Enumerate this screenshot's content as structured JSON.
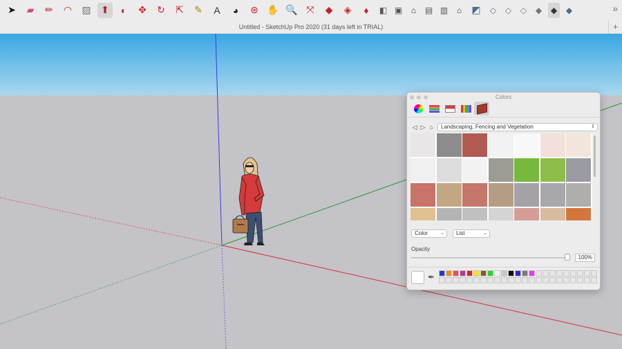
{
  "window": {
    "title": "Untitled - SketchUp Pro 2020 (31 days left in TRIAL)",
    "new_tab": "+"
  },
  "toolbar": {
    "tools": [
      {
        "name": "select-tool-icon",
        "glyph": "➤",
        "color": "#111111"
      },
      {
        "name": "eraser-tool-icon",
        "glyph": "▰",
        "color": "#d94b76"
      },
      {
        "name": "line-tool-icon",
        "glyph": "✏",
        "color": "#aa2222"
      },
      {
        "name": "arc-tool-icon",
        "glyph": "◠",
        "color": "#cc2222"
      },
      {
        "name": "rectangle-tool-icon",
        "glyph": "▨",
        "color": "#777777"
      },
      {
        "name": "push-pull-tool-icon",
        "glyph": "⬆",
        "color": "#aa2222",
        "active": true
      },
      {
        "name": "offset-tool-icon",
        "glyph": "◐",
        "color": "#cc2222"
      },
      {
        "name": "move-tool-icon",
        "glyph": "✥",
        "color": "#dd2222"
      },
      {
        "name": "rotate-tool-icon",
        "glyph": "↻",
        "color": "#dd2222"
      },
      {
        "name": "scale-tool-icon",
        "glyph": "⇱",
        "color": "#cc2222"
      },
      {
        "name": "tape-measure-tool-icon",
        "glyph": "✎",
        "color": "#aa8800"
      },
      {
        "name": "text-tool-icon",
        "glyph": "A",
        "color": "#333333"
      },
      {
        "name": "paint-bucket-tool-icon",
        "glyph": "◕",
        "color": "#222222"
      },
      {
        "name": "orbit-tool-icon",
        "glyph": "⊛",
        "color": "#cc2222"
      },
      {
        "name": "pan-tool-icon",
        "glyph": "✋",
        "color": "#c8a070"
      },
      {
        "name": "zoom-tool-icon",
        "glyph": "🔍",
        "color": "#333333"
      },
      {
        "name": "zoom-extents-tool-icon",
        "glyph": "⤧",
        "color": "#cc2222"
      },
      {
        "name": "3d-warehouse-icon",
        "glyph": "◆",
        "color": "#cc2222"
      },
      {
        "name": "extension-warehouse-icon",
        "glyph": "◈",
        "color": "#cc2222"
      },
      {
        "name": "ruby-icon",
        "glyph": "♦",
        "color": "#cc2222"
      },
      {
        "name": "iso-view-icon",
        "glyph": "◧",
        "color": "#555555",
        "small": true
      },
      {
        "name": "top-view-icon",
        "glyph": "▣",
        "color": "#555555",
        "small": true
      },
      {
        "name": "front-view-icon",
        "glyph": "⌂",
        "color": "#333333",
        "small": true
      },
      {
        "name": "right-view-icon",
        "glyph": "▤",
        "color": "#555555",
        "small": true
      },
      {
        "name": "back-view-icon",
        "glyph": "▥",
        "color": "#555555",
        "small": true
      },
      {
        "name": "left-view-icon",
        "glyph": "⌂",
        "color": "#333333",
        "small": true
      },
      {
        "name": "xray-style-icon",
        "glyph": "◩",
        "color": "#4a6d8c"
      },
      {
        "name": "back-edges-style-icon",
        "glyph": "◇",
        "color": "#4a6d8c",
        "small": true
      },
      {
        "name": "wireframe-style-icon",
        "glyph": "◇",
        "color": "#777777",
        "small": true
      },
      {
        "name": "hidden-line-style-icon",
        "glyph": "◇",
        "color": "#777777",
        "small": true
      },
      {
        "name": "shaded-style-icon",
        "glyph": "◆",
        "color": "#777777",
        "small": true
      },
      {
        "name": "shaded-textures-style-icon",
        "glyph": "◆",
        "color": "#333333",
        "small": true,
        "active": true
      },
      {
        "name": "monochrome-style-icon",
        "glyph": "◆",
        "color": "#4a6d8c",
        "small": true
      }
    ],
    "more_glyph": "»"
  },
  "colors_panel": {
    "title": "Colors",
    "tabs": [
      {
        "name": "color-wheel-tab-icon",
        "kind": "wheel"
      },
      {
        "name": "color-sliders-tab-icon",
        "kind": "sliders"
      },
      {
        "name": "color-palettes-tab-icon",
        "kind": "palettes"
      },
      {
        "name": "image-palettes-tab-icon",
        "kind": "pencils"
      },
      {
        "name": "materials-tab-icon",
        "kind": "brick",
        "active": true
      }
    ],
    "nav": {
      "back": "◁",
      "forward": "▷",
      "home": "⌂"
    },
    "collection": "Landscaping, Fencing and Vegetation",
    "swatches": [
      [
        "#e8e6e6",
        "#8c8c8c",
        "#b15a52",
        "#f2f2f2",
        "#f8f8f8",
        "#f4e0da",
        "#f2e6dc"
      ],
      [
        "#f0f0f0",
        "#dcdcdc",
        "#f2f2f2",
        "#9c9c94",
        "#76b93c",
        "#8fbd4a",
        "#9a9aa2"
      ],
      [
        "#c9736a",
        "#c2a882",
        "#c5776a",
        "#b59c84",
        "#a4a2a6",
        "#a8a8ac",
        "#b0aeac"
      ],
      [
        "#e0c090",
        "#b4b4b4",
        "#c0c0c0",
        "#d4d4d4",
        "#d49e96",
        "#d8bca0",
        "#d4763c"
      ]
    ],
    "color_select": "Color",
    "list_select": "List",
    "opacity_label": "Opacity",
    "opacity_value": "100%",
    "opacity_fraction": 1.0,
    "palette": [
      "#1f3bd0",
      "#f08a2a",
      "#e85050",
      "#b03a9a",
      "#d42a2a",
      "#f2e22a",
      "#8a5a2a",
      "#2ad42a",
      "#f2f2f2",
      "#c8c8c8",
      "#111111",
      "#2a2ad4",
      "#7a7a7a",
      "#e83ae8"
    ]
  }
}
